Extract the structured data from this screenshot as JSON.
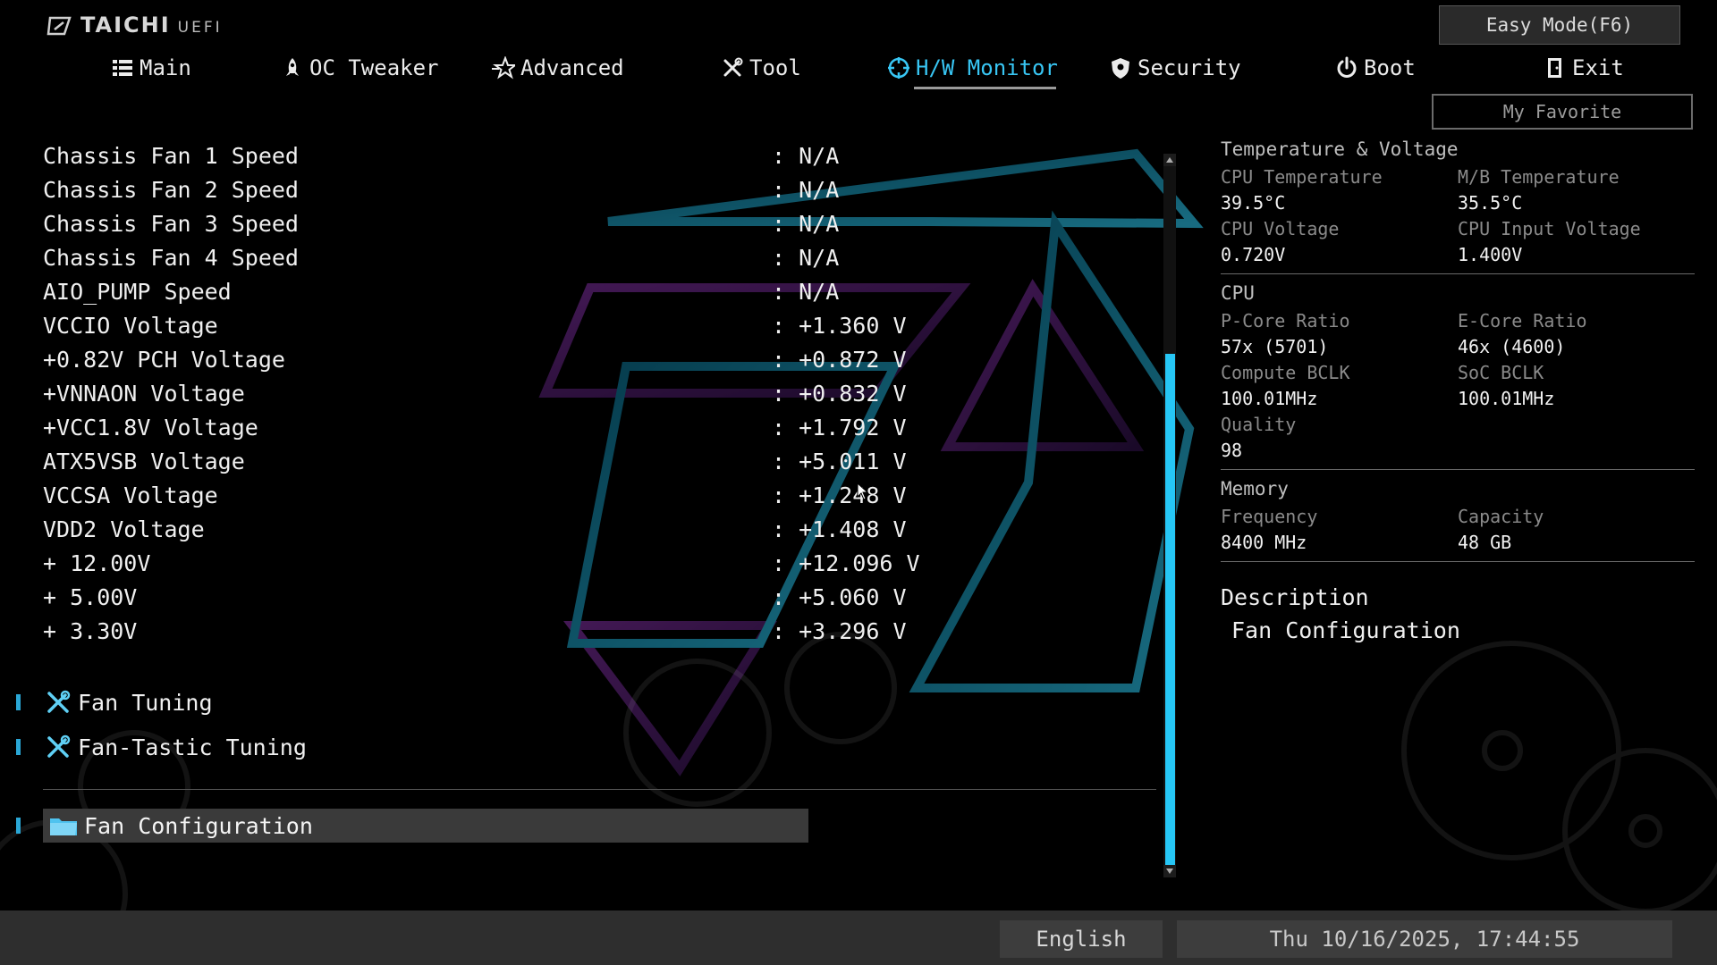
{
  "brand": {
    "name": "TAICHI",
    "sub": "UEFI"
  },
  "header": {
    "easy_mode": "Easy Mode(F6)",
    "my_favorite": "My Favorite"
  },
  "nav": [
    {
      "label": "Main",
      "icon": "list-icon",
      "active": false
    },
    {
      "label": "OC Tweaker",
      "icon": "rocket-icon",
      "active": false
    },
    {
      "label": "Advanced",
      "icon": "star-icon",
      "active": false
    },
    {
      "label": "Tool",
      "icon": "tools-icon",
      "active": false
    },
    {
      "label": "H/W Monitor",
      "icon": "crosshair-icon",
      "active": true
    },
    {
      "label": "Security",
      "icon": "shield-icon",
      "active": false
    },
    {
      "label": "Boot",
      "icon": "power-icon",
      "active": false
    },
    {
      "label": "Exit",
      "icon": "exit-door-icon",
      "active": false
    }
  ],
  "readings": [
    {
      "label": "Chassis Fan 1 Speed",
      "value": ": N/A"
    },
    {
      "label": "Chassis Fan 2 Speed",
      "value": ": N/A"
    },
    {
      "label": "Chassis Fan 3 Speed",
      "value": ": N/A"
    },
    {
      "label": "Chassis Fan 4 Speed",
      "value": ": N/A"
    },
    {
      "label": "AIO_PUMP Speed",
      "value": ": N/A"
    },
    {
      "label": "VCCIO Voltage",
      "value": ": +1.360 V"
    },
    {
      "label": "+0.82V PCH Voltage",
      "value": ": +0.872 V"
    },
    {
      "label": "+VNNAON Voltage",
      "value": ": +0.832 V"
    },
    {
      "label": "+VCC1.8V Voltage",
      "value": ": +1.792 V"
    },
    {
      "label": "ATX5VSB Voltage",
      "value": ": +5.011 V"
    },
    {
      "label": "VCCSA Voltage",
      "value": ": +1.248 V"
    },
    {
      "label": "VDD2 Voltage",
      "value": ": +1.408 V"
    },
    {
      "label": "+ 12.00V",
      "value": ": +12.096 V"
    },
    {
      "label": "+ 5.00V",
      "value": ": +5.060 V"
    },
    {
      "label": "+ 3.30V",
      "value": ": +3.296 V"
    }
  ],
  "tools": [
    {
      "label": "Fan Tuning",
      "icon": "tools-icon"
    },
    {
      "label": "Fan-Tastic Tuning",
      "icon": "tools-icon"
    }
  ],
  "selected_item": {
    "label": "Fan Configuration",
    "icon": "folder-icon"
  },
  "panel": {
    "temp_voltage": {
      "title": "Temperature & Voltage",
      "cpu_temp_label": "CPU Temperature",
      "cpu_temp": "39.5°C",
      "mb_temp_label": "M/B Temperature",
      "mb_temp": "35.5°C",
      "cpu_volt_label": "CPU Voltage",
      "cpu_volt": "0.720V",
      "cpu_input_label": "CPU Input Voltage",
      "cpu_input": "1.400V"
    },
    "cpu": {
      "title": "CPU",
      "pcore_label": "P-Core Ratio",
      "pcore": "57x (5701)",
      "ecore_label": "E-Core Ratio",
      "ecore": "46x (4600)",
      "bclk_label": "Compute BCLK",
      "bclk": "100.01MHz",
      "soc_label": "SoC BCLK",
      "soc": "100.01MHz",
      "quality_label": "Quality",
      "quality": "98"
    },
    "memory": {
      "title": "Memory",
      "freq_label": "Frequency",
      "freq": "8400 MHz",
      "cap_label": "Capacity",
      "cap": "48 GB"
    },
    "description": {
      "title": "Description",
      "text": "Fan Configuration"
    }
  },
  "footer": {
    "language": "English",
    "datetime": "Thu 10/16/2025, 17:44:55"
  },
  "colors": {
    "accent": "#26c6f5",
    "highlight_row": "#3a3a3a",
    "bar": "#2e2e2e"
  }
}
